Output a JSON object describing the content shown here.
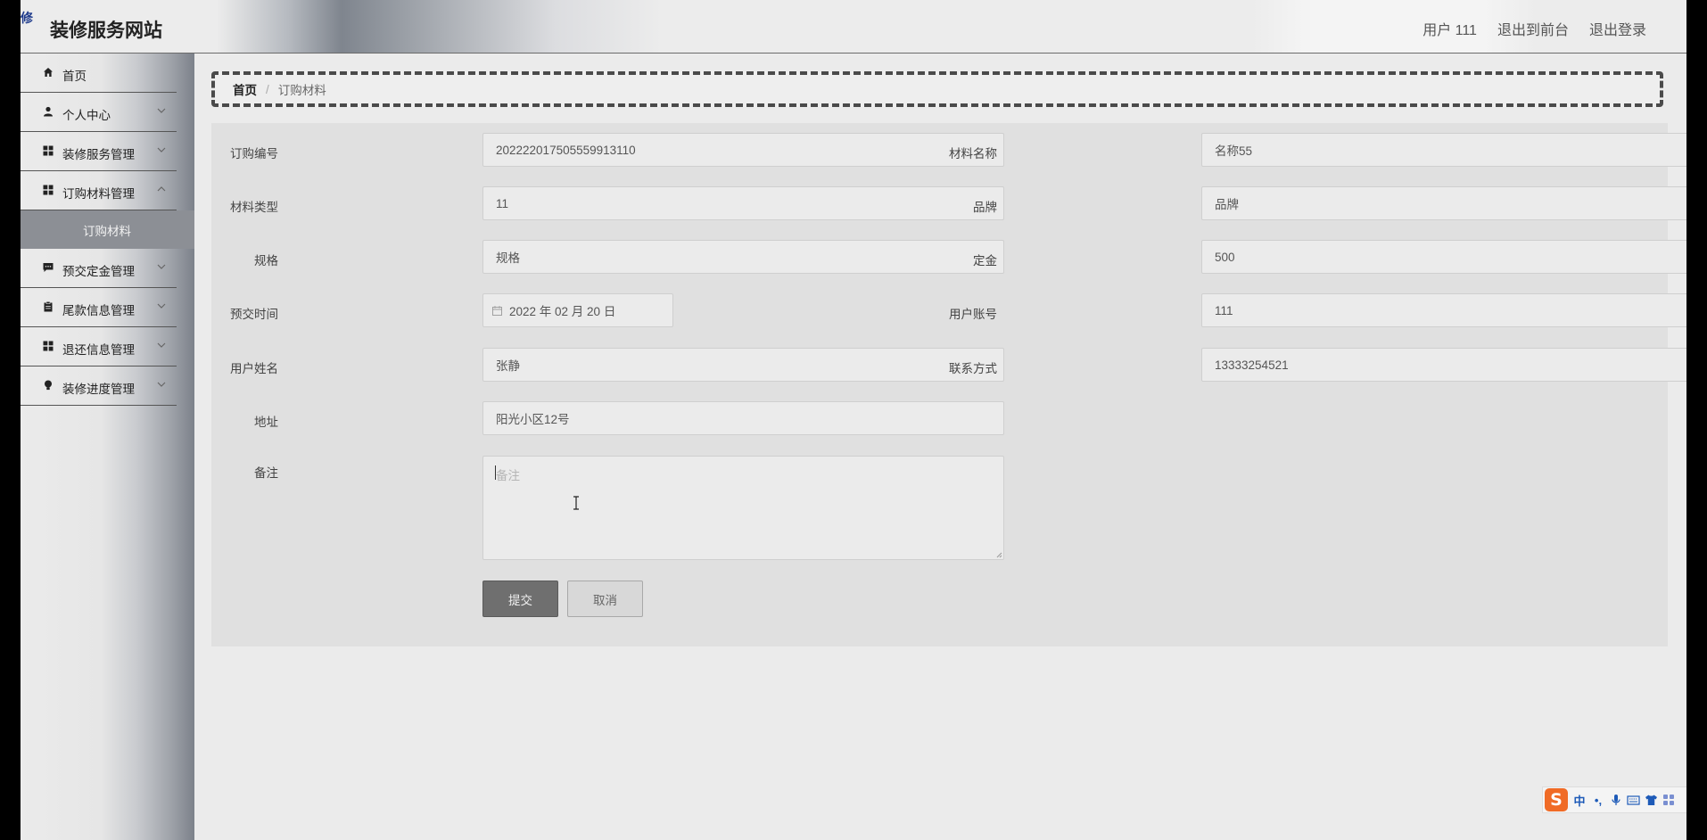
{
  "header": {
    "logo_badge": "智修",
    "site_title": "装修服务网站",
    "links": [
      "用户 111",
      "退出到前台",
      "退出登录"
    ]
  },
  "sidebar": {
    "items": [
      {
        "label": "首页",
        "icon": "home-icon",
        "has_children": false
      },
      {
        "label": "个人中心",
        "icon": "user-icon",
        "has_children": true
      },
      {
        "label": "装修服务管理",
        "icon": "grid-icon",
        "has_children": true
      },
      {
        "label": "订购材料管理",
        "icon": "grid-icon",
        "has_children": true,
        "expanded": true
      },
      {
        "label": "预交定金管理",
        "icon": "message-icon",
        "has_children": true
      },
      {
        "label": "尾款信息管理",
        "icon": "clipboard-icon",
        "has_children": true
      },
      {
        "label": "退还信息管理",
        "icon": "grid-icon",
        "has_children": true
      },
      {
        "label": "装修进度管理",
        "icon": "bulb-icon",
        "has_children": true
      }
    ],
    "submenu": {
      "label": "订购材料"
    }
  },
  "breadcrumb": {
    "home": "首页",
    "separator": "/",
    "current": "订购材料"
  },
  "form": {
    "order_no": {
      "label": "订购编号",
      "value": "202222017505559913110"
    },
    "material_name": {
      "label": "材料名称",
      "value": "名称55"
    },
    "material_type": {
      "label": "材料类型",
      "value": "11"
    },
    "brand": {
      "label": "品牌",
      "value": "品牌"
    },
    "spec": {
      "label": "规格",
      "value": "规格"
    },
    "deposit": {
      "label": "定金",
      "value": "500"
    },
    "prepay_time": {
      "label": "预交时间",
      "value": "2022 年 02 月 20 日"
    },
    "user_account": {
      "label": "用户账号",
      "value": "111"
    },
    "user_name": {
      "label": "用户姓名",
      "value": "张静"
    },
    "contact": {
      "label": "联系方式",
      "value": "13333254521"
    },
    "address": {
      "label": "地址",
      "value": "阳光小区12号"
    },
    "remark": {
      "label": "备注",
      "placeholder": "备注"
    },
    "submit_label": "提交",
    "cancel_label": "取消"
  },
  "ime_toolbar": {
    "logo": "S",
    "mode": "中",
    "punct": "•,"
  },
  "colors": {
    "submit_bg": "#6f6f6f",
    "panel_bg": "#e0e0e0",
    "ime_orange": "#f06b26",
    "ime_blue": "#1e5bb8"
  }
}
